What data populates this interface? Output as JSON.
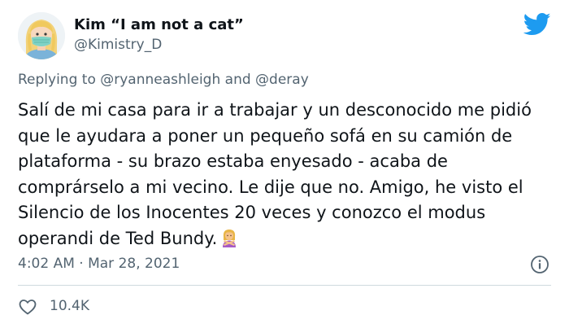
{
  "author": {
    "display_name": "Kim “I am not a cat”",
    "handle": "@Kimistry_D",
    "avatar_icon": "avatar-woman-mask",
    "brand_icon": "twitter-bird-icon",
    "brand_color": "#1d9bf0"
  },
  "reply": {
    "prefix": "Replying to",
    "mention_1": "@ryanneashleigh",
    "joiner": "and",
    "mention_2": "@deray"
  },
  "tweet": {
    "lines": [
      "Salí de mi casa para ir a trabajar y un desconocido me pidió",
      "que le ayudara a poner un pequeño sofá en su camión de",
      "plataforma - su brazo estaba enyesado - acaba de",
      "comprárselo a mi vecino. Le dije que no. Amigo, he visto el",
      "Silencio de los Inocentes 20 veces y conozco el modus",
      "operandi de Ted Bundy."
    ],
    "emoji": "woman-gesturing-no"
  },
  "meta": {
    "timestamp": "4:02 AM · Mar 28, 2021",
    "info_icon": "info-icon"
  },
  "engagement": {
    "like_icon": "heart-icon",
    "likes": "10.4K"
  },
  "colors": {
    "text": "#0f1419",
    "secondary": "#536471",
    "divider": "#cfd9de"
  }
}
